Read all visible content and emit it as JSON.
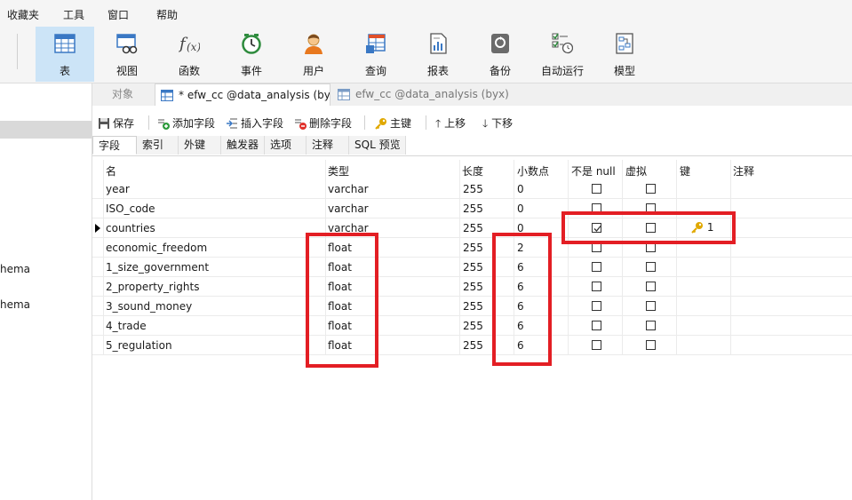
{
  "menu": [
    "收藏夹",
    "工具",
    "窗口",
    "帮助"
  ],
  "toolbar": [
    {
      "label": "表",
      "icon": "table-icon",
      "active": true
    },
    {
      "label": "视图",
      "icon": "view-icon"
    },
    {
      "label": "函数",
      "icon": "function-icon"
    },
    {
      "label": "事件",
      "icon": "clock-icon"
    },
    {
      "label": "用户",
      "icon": "user-icon"
    },
    {
      "label": "查询",
      "icon": "query-icon"
    },
    {
      "label": "报表",
      "icon": "report-icon"
    },
    {
      "label": "备份",
      "icon": "backup-icon"
    },
    {
      "label": "自动运行",
      "icon": "autorun-icon"
    },
    {
      "label": "模型",
      "icon": "model-icon"
    }
  ],
  "sidebar": {
    "items": [
      "hema",
      "hema"
    ]
  },
  "tabs": {
    "objects": "对象",
    "active": "* efw_cc @data_analysis (by...",
    "inactive": "efw_cc @data_analysis (byx)..."
  },
  "edit_toolbar": {
    "save": "保存",
    "add_field": "添加字段",
    "insert_field": "插入字段",
    "delete_field": "删除字段",
    "primary_key": "主键",
    "move_up": "上移",
    "move_down": "下移"
  },
  "subtabs": [
    "字段",
    "索引",
    "外键",
    "触发器",
    "选项",
    "注释",
    "SQL 预览"
  ],
  "columns": {
    "name": "名",
    "type": "类型",
    "length": "长度",
    "decimals": "小数点",
    "not_null": "不是 null",
    "virtual": "虚拟",
    "key": "键",
    "comment": "注释"
  },
  "rows": [
    {
      "name": "year",
      "type": "varchar",
      "length": "255",
      "decimals": "0",
      "not_null": false,
      "virtual": false,
      "key": ""
    },
    {
      "name": "ISO_code",
      "type": "varchar",
      "length": "255",
      "decimals": "0",
      "not_null": false,
      "virtual": false,
      "key": ""
    },
    {
      "name": "countries",
      "type": "varchar",
      "length": "255",
      "decimals": "0",
      "not_null": true,
      "virtual": false,
      "key": "1"
    },
    {
      "name": "economic_freedom",
      "type": "float",
      "length": "255",
      "decimals": "2",
      "not_null": false,
      "virtual": false,
      "key": ""
    },
    {
      "name": "1_size_government",
      "type": "float",
      "length": "255",
      "decimals": "6",
      "not_null": false,
      "virtual": false,
      "key": ""
    },
    {
      "name": "2_property_rights",
      "type": "float",
      "length": "255",
      "decimals": "6",
      "not_null": false,
      "virtual": false,
      "key": ""
    },
    {
      "name": "3_sound_money",
      "type": "float",
      "length": "255",
      "decimals": "6",
      "not_null": false,
      "virtual": false,
      "key": ""
    },
    {
      "name": "4_trade",
      "type": "float",
      "length": "255",
      "decimals": "6",
      "not_null": false,
      "virtual": false,
      "key": ""
    },
    {
      "name": "5_regulation",
      "type": "float",
      "length": "255",
      "decimals": "6",
      "not_null": false,
      "virtual": false,
      "key": ""
    }
  ],
  "colors": {
    "highlight": "#e31e24",
    "active_tool": "#cce4f7",
    "key_icon": "#e0a800"
  }
}
